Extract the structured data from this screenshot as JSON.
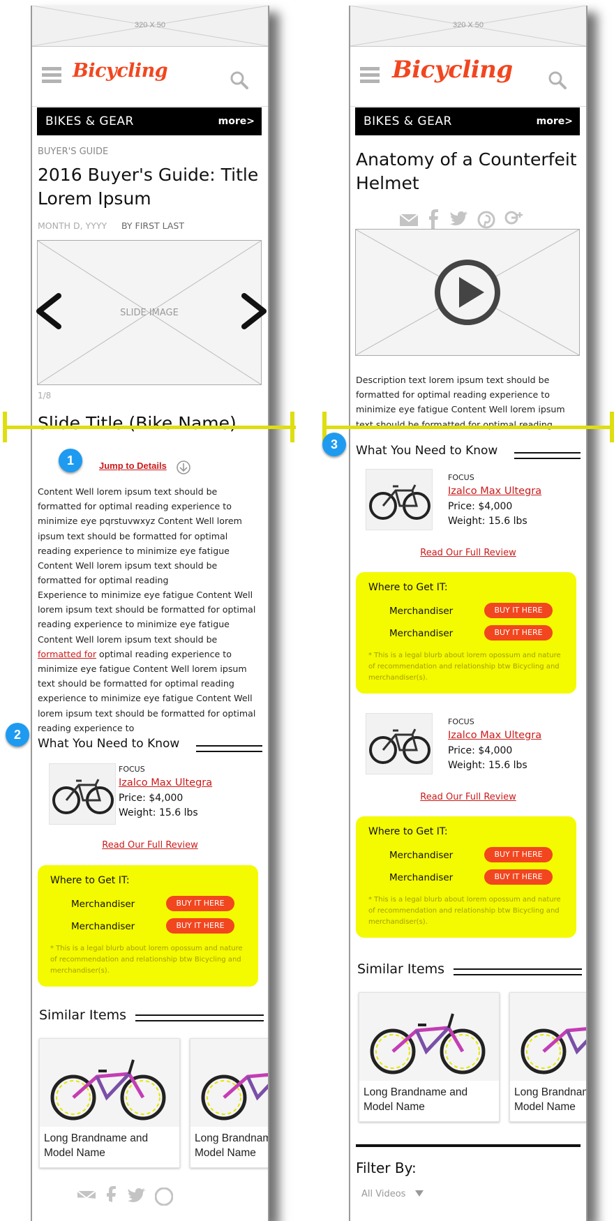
{
  "ad": {
    "label": "320 X 50"
  },
  "header": {
    "logo": "Bicycling"
  },
  "section": {
    "title": "BIKES & GEAR",
    "more": "more>"
  },
  "left": {
    "kicker": "BUYER'S GUIDE",
    "headline": "2016 Buyer's Guide: Title Lorem Ipsum",
    "date": "MONTH D, YYYY",
    "byline": "BY FIRST LAST",
    "slide_label": "SLIDE IMAGE",
    "slide_counter": "1/8",
    "slide_title": "Slide Title (Bike Name)",
    "jump_link": "Jump to Details",
    "para1": "Content Well lorem ipsum text should be formatted for optimal reading experience to minimize eye pqrstuvwxyz Content Well lorem ipsum text should be formatted for optimal reading experience to minimize eye fatigue Content Well lorem ipsum text should be formatted for optimal reading",
    "para2_before": "Experience to minimize eye fatigue Content Well lorem ipsum text should be formatted for optimal reading experience to minimize eye fatigue Content Well lorem ipsum text should be ",
    "para2_link": "formatted for",
    "para2_after": " optimal reading experience to minimize eye fatigue Content Well lorem ipsum text should be formatted for optimal reading experience to minimize eye fatigue Content Well lorem ipsum text should be formatted for optimal reading experience to",
    "share_icons": [
      "mail-icon",
      "facebook-icon",
      "twitter-icon",
      "pinterest-icon",
      "google-plus-icon"
    ]
  },
  "right": {
    "headline": "Anatomy of a Counterfeit Helmet",
    "share_icons": [
      "mail-icon",
      "facebook-icon",
      "twitter-icon",
      "pinterest-icon",
      "google-plus-icon"
    ],
    "description": "Description text lorem ipsum text should be formatted for optimal reading experience to minimize eye fatigue Content Well lorem ipsum text should be formatted for optimal reading",
    "filter_label": "Filter By:",
    "filter_value": "All Videos"
  },
  "wytk": {
    "title": "What You Need to Know"
  },
  "product": {
    "brand": "FOCUS",
    "name": "Izalco Max Ultegra",
    "price": "Price: $4,000",
    "weight": "Weight: 15.6 lbs",
    "review_link": "Read Our Full Review"
  },
  "where": {
    "title": "Where to Get IT:",
    "merchants": [
      "Merchandiser",
      "Merchandiser"
    ],
    "buy_label": "BUY IT HERE",
    "blurb": "* This is a legal blurb about lorem opossum and nature of recommendation and relationship btw Bicycling and merchandiser(s)."
  },
  "similar": {
    "title": "Similar Items",
    "items": [
      "Long Brandname and Model Name",
      "Long Brandname and Model Name"
    ]
  },
  "badges": [
    "1",
    "2",
    "3"
  ],
  "colors": {
    "brand_red": "#f2461f",
    "link_red": "#cc1a1a",
    "highlight_yellow": "#f4fa00",
    "badge_blue": "#1e9bf0",
    "marker_yellow": "#dede10"
  }
}
